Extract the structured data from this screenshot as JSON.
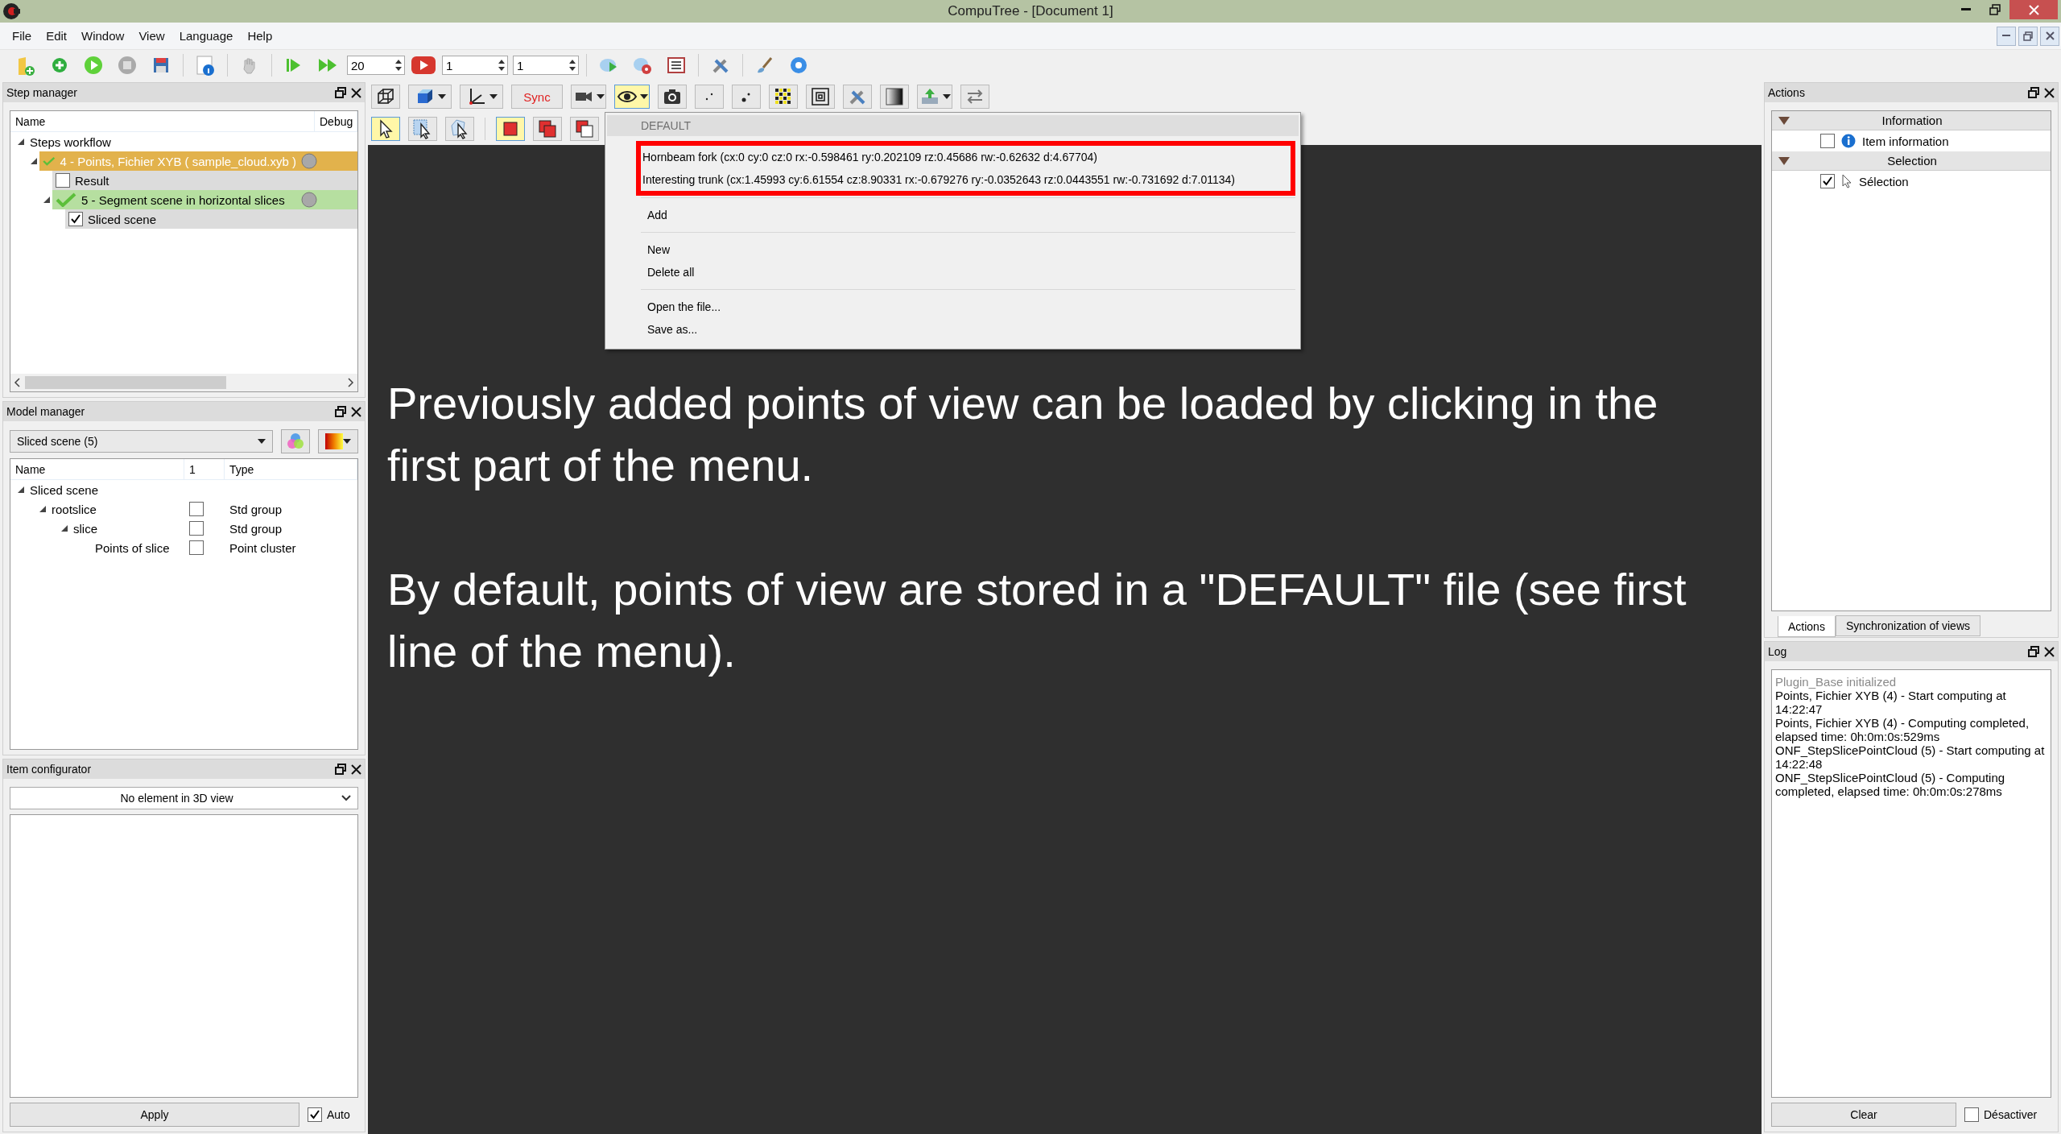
{
  "window": {
    "title": "CompuTree - [Document 1]"
  },
  "menu_bar": [
    "File",
    "Edit",
    "Window",
    "View",
    "Language",
    "Help"
  ],
  "toolbar": {
    "spin_steps": "20",
    "spin_first": "1",
    "spin_second": "1"
  },
  "step_manager": {
    "title": "Step manager",
    "columns": [
      "Name",
      "Debug"
    ],
    "tree": [
      {
        "kind": "folder",
        "label": "Steps workflow",
        "children": [
          {
            "kind": "step",
            "label": "4 - Points, Fichier XYB ( sample_cloud.xyb )",
            "color": "#e2b24c",
            "children": [
              {
                "kind": "result",
                "label": "Result",
                "checked": false
              },
              {
                "kind": "step",
                "label": "5 - Segment scene in horizontal slices",
                "color": "#b6dfa0",
                "children": [
                  {
                    "kind": "result",
                    "label": "Sliced scene",
                    "checked": true
                  }
                ]
              }
            ]
          }
        ]
      }
    ]
  },
  "model_manager": {
    "title": "Model manager",
    "combo": "Sliced scene (5)",
    "columns": [
      "Name",
      "1",
      "Type"
    ],
    "tree": [
      {
        "label": "Sliced scene",
        "children": [
          {
            "label": "rootslice",
            "checked": false,
            "type": "Std group",
            "children": [
              {
                "label": "slice",
                "checked": false,
                "type": "Std group",
                "children": [
                  {
                    "label": "Points of slice",
                    "checked": false,
                    "type": "Point cluster"
                  }
                ]
              }
            ]
          }
        ]
      }
    ]
  },
  "item_configurator": {
    "title": "Item configurator",
    "combo": "No element in 3D view",
    "apply": "Apply",
    "auto": {
      "label": "Auto",
      "checked": true
    }
  },
  "view_toolbar": {
    "sync": "Sync",
    "selection_modes": [
      {
        "selected": true
      },
      {
        "selected": false
      },
      {
        "selected": false
      }
    ],
    "selection_ops": [
      {
        "selected": true
      },
      {
        "selected": false
      },
      {
        "selected": false
      }
    ]
  },
  "view_menu": {
    "header": "DEFAULT",
    "sections": [
      {
        "highlighted": true,
        "items": [
          "Hornbeam fork (cx:0 cy:0 cz:0 rx:-0.598461 ry:0.202109 rz:0.45686 rw:-0.62632 d:4.67704)",
          "Interesting trunk (cx:1.45993 cy:6.61554 cz:8.90331 rx:-0.679276 ry:-0.0352643 rz:0.0443551 rw:-0.731692 d:7.01134)"
        ]
      },
      {
        "highlighted": false,
        "items": [
          "Add"
        ]
      },
      {
        "highlighted": false,
        "items": [
          "New",
          "Delete all"
        ]
      },
      {
        "highlighted": false,
        "items": [
          "Open the file...",
          "Save as..."
        ]
      }
    ]
  },
  "canvas_text": [
    "Previously added points of view can be loaded by clicking in the first part of the menu.",
    "By default, points of view are stored in a \"DEFAULT\" file (see first line of the menu)."
  ],
  "actions": {
    "title": "Actions",
    "groups": [
      {
        "label": "Information",
        "items": [
          {
            "kind": "info",
            "label": "Item information",
            "checked": false
          }
        ]
      },
      {
        "label": "Selection",
        "items": [
          {
            "kind": "pointer",
            "label": "Sélection",
            "checked": true
          }
        ]
      }
    ],
    "tabs": [
      {
        "label": "Actions",
        "selected": true
      },
      {
        "label": "Synchronization of views",
        "selected": false
      }
    ]
  },
  "log": {
    "title": "Log",
    "lines": [
      {
        "kind": "status",
        "text": "Plugin_Base initialized"
      },
      {
        "kind": "message",
        "text": "Points, Fichier XYB (4) - Start computing at 14:22:47"
      },
      {
        "kind": "message",
        "text": "Points, Fichier XYB (4) - Computing completed, elapsed time: 0h:0m:0s:529ms"
      },
      {
        "kind": "message",
        "text": "ONF_StepSlicePointCloud (5) - Start computing at 14:22:48"
      },
      {
        "kind": "message",
        "text": "ONF_StepSlicePointCloud (5) - Computing completed, elapsed time: 0h:0m:0s:278ms"
      }
    ],
    "clear": "Clear",
    "disable": {
      "label": "Désactiver",
      "checked": false
    }
  }
}
